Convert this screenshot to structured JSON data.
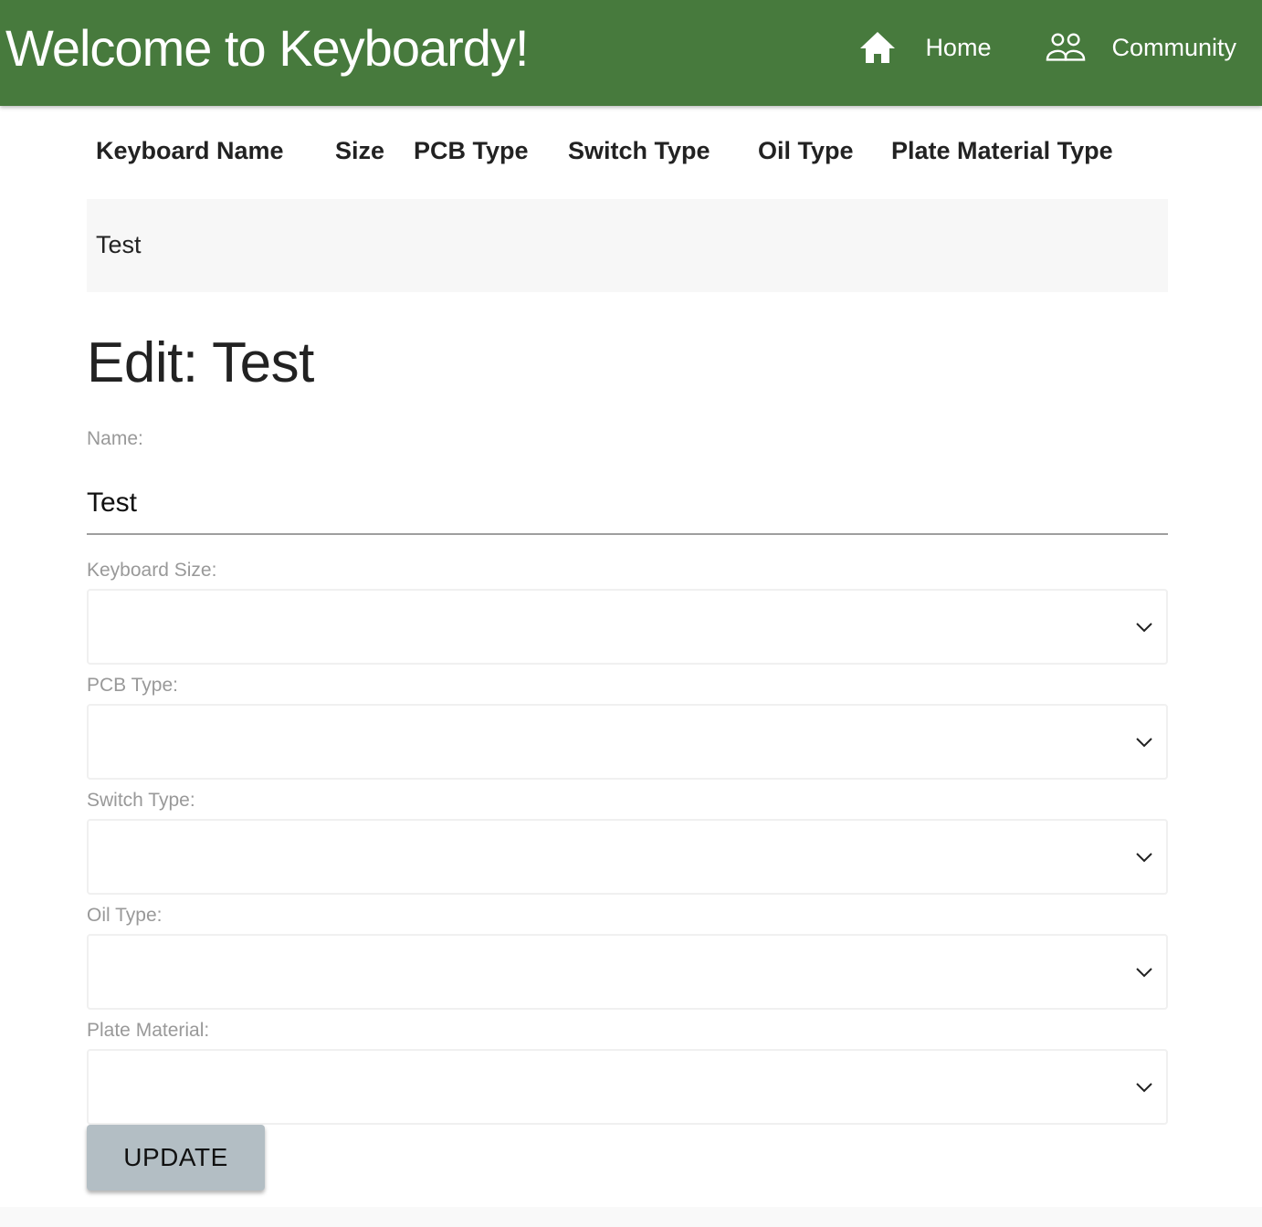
{
  "header": {
    "title": "Welcome to Keyboardy!",
    "nav": [
      {
        "label": "Home",
        "icon": "home-icon"
      },
      {
        "label": "Community",
        "icon": "people-icon"
      }
    ],
    "brand_color": "#477a3d"
  },
  "table": {
    "columns": [
      "Keyboard Name",
      "Size",
      "PCB Type",
      "Switch Type",
      "Oil Type",
      "Plate Material Type"
    ],
    "rows": [
      {
        "keyboard_name": "Test",
        "size": "",
        "pcb_type": "",
        "switch_type": "",
        "oil_type": "",
        "plate_material_type": ""
      }
    ]
  },
  "form": {
    "title": "Edit: Test",
    "name_label": "Name:",
    "name_value": "Test",
    "selects": [
      {
        "label": "Keyboard Size:",
        "value": ""
      },
      {
        "label": "PCB Type:",
        "value": ""
      },
      {
        "label": "Switch Type:",
        "value": ""
      },
      {
        "label": "Oil Type:",
        "value": ""
      },
      {
        "label": "Plate Material:",
        "value": ""
      }
    ],
    "submit_label": "UPDATE"
  }
}
